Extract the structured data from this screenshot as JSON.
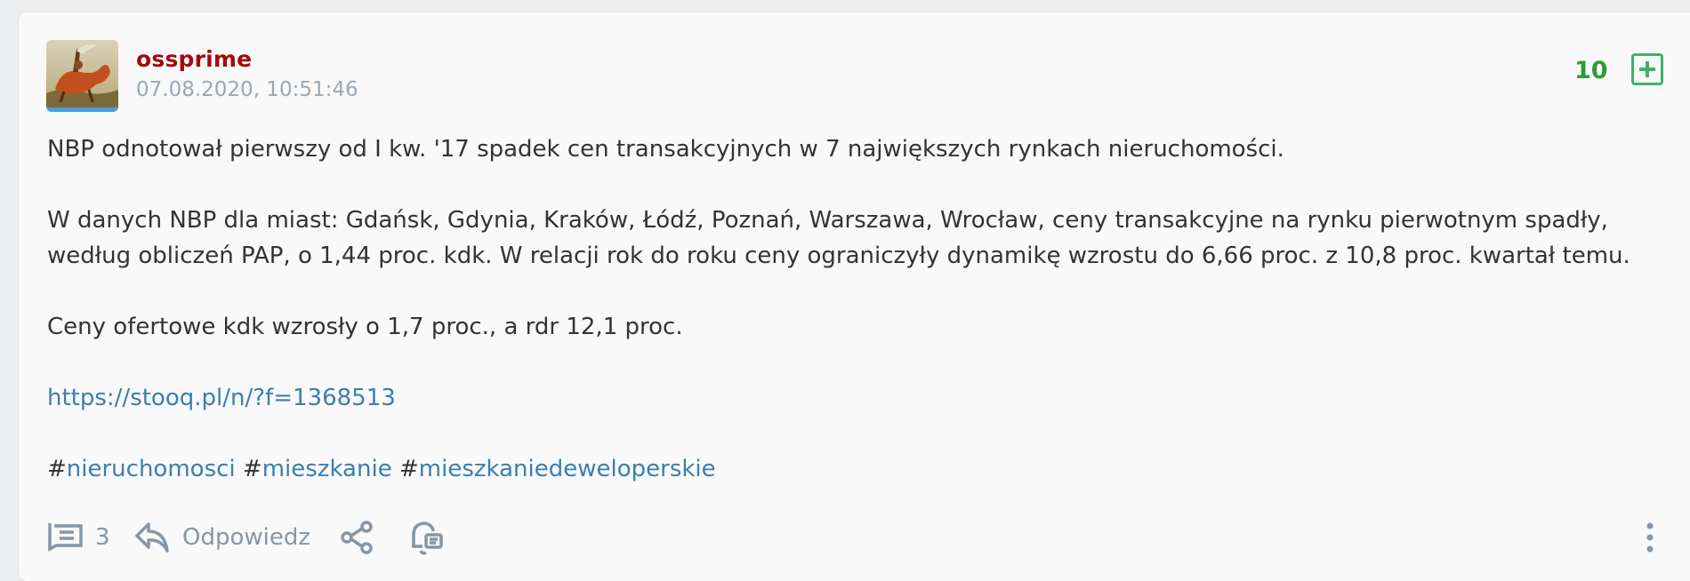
{
  "post": {
    "username": "ossprime",
    "timestamp": "07.08.2020, 10:51:46",
    "score": "10",
    "paragraph1": "NBP odnotował pierwszy od I kw. '17 spadek cen transakcyjnych w 7 największych rynkach nieruchomości.",
    "paragraph2a": "W danych NBP dla miast: Gdańsk, Gdynia, Kraków, Łódź, Poznań, Warszawa, Wrocław, ceny transakcyjne na rynku pierwotnym spadły,",
    "paragraph2b": "według obliczeń PAP, o 1,44 proc. kdk. W relacji rok do roku ceny ograniczyły dynamikę wzrostu do 6,66 proc. z 10,8 proc. kwartał temu.",
    "paragraph3": "Ceny ofertowe kdk wzrosły o 1,7 proc., a rdr 12,1 proc.",
    "link": "https://stooq.pl/n/?f=1368513",
    "tags": [
      {
        "hash": "#",
        "name": "nieruchomosci"
      },
      {
        "hash": "#",
        "name": "mieszkanie"
      },
      {
        "hash": "#",
        "name": "mieszkaniedeweloperskie"
      }
    ]
  },
  "footer": {
    "comments_count": "3",
    "reply_label": "Odpowiedz"
  },
  "colors": {
    "username": "#a30b0b",
    "score": "#2e9a3a",
    "link": "#3b7fb0",
    "muted": "#8796a5"
  }
}
